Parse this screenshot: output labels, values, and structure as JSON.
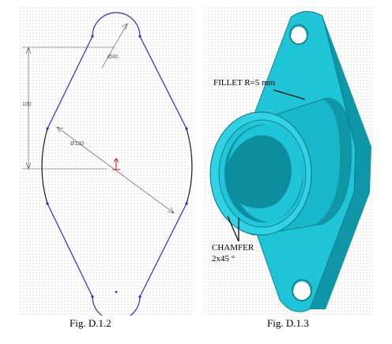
{
  "left_figure": {
    "caption": "Fig. D.1.2",
    "dimensions": {
      "top_diameter": "Ø40",
      "center_diameter": "Ø120",
      "height": "100"
    },
    "colors": {
      "outline": "#2b2bd6",
      "arc": "#1a1a1a",
      "dimension": "#444444",
      "origin": "#e01010"
    }
  },
  "right_figure": {
    "caption": "Fig. D.1.3",
    "annotations": {
      "fillet": "FILLET R=5 mm",
      "chamfer_line1": "CHAMFER",
      "chamfer_line2": "2x45 °"
    },
    "colors": {
      "body": "#1fc4d6",
      "shadow": "#0f97a8",
      "dark": "#0a6f7c"
    }
  }
}
